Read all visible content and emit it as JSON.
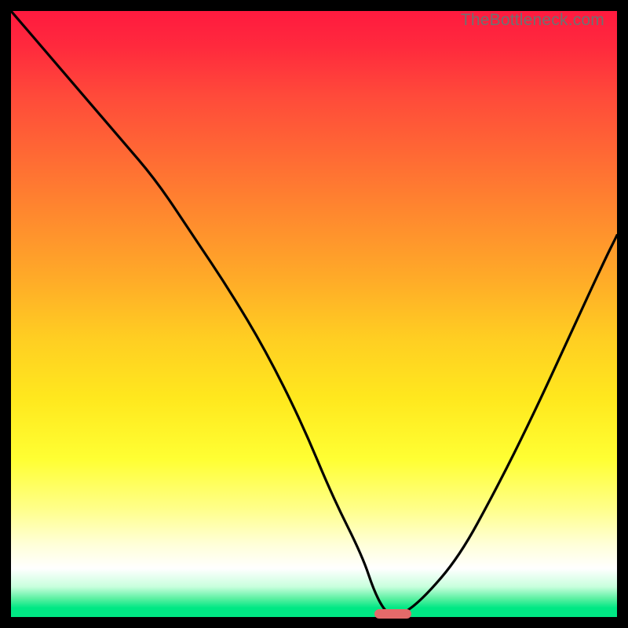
{
  "watermark": "TheBottleneck.com",
  "colors": {
    "frame": "#000000",
    "curve": "#000000",
    "marker": "#e46a6a"
  },
  "chart_data": {
    "type": "line",
    "title": "",
    "xlabel": "",
    "ylabel": "",
    "xlim": [
      0,
      100
    ],
    "ylim": [
      0,
      100
    ],
    "grid": false,
    "series": [
      {
        "name": "bottleneck-curve",
        "x": [
          0,
          6,
          12,
          18,
          24,
          30,
          36,
          42,
          48,
          53,
          58,
          60,
          62,
          64,
          68,
          74,
          80,
          86,
          92,
          98,
          100
        ],
        "values": [
          100,
          93,
          86,
          79,
          72,
          63,
          54,
          44,
          32,
          20,
          10,
          4,
          0.5,
          0,
          3,
          10,
          21,
          33,
          46,
          59,
          63
        ]
      }
    ],
    "annotations": [
      {
        "name": "optimal-range-marker",
        "x_start": 60,
        "x_end": 66,
        "y": 0.5
      }
    ],
    "background_gradient": {
      "top": "#ff1a3f",
      "mid": "#ffff33",
      "bottom": "#00e884"
    }
  }
}
